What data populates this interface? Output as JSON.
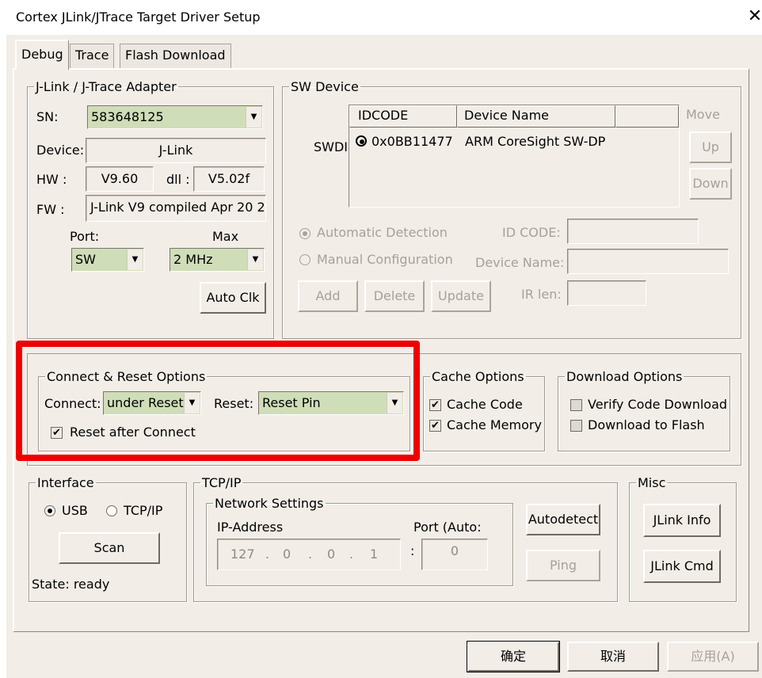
{
  "window": {
    "title": "Cortex JLink/JTrace Target Driver Setup",
    "close_glyph": "✕"
  },
  "tabs": [
    "Debug",
    "Trace",
    "Flash Download"
  ],
  "adapter": {
    "legend": "J-Link / J-Trace Adapter",
    "sn_label": "SN:",
    "sn_value": "583648125",
    "device_label": "Device:",
    "device_value": "J-Link",
    "hw_label": "HW :",
    "hw_value": "V9.60",
    "dll_label": "dll :",
    "dll_value": "V5.02f",
    "fw_label": "FW :",
    "fw_value": "J-Link V9 compiled Apr 20 2",
    "port_label": "Port:",
    "port_value": "SW",
    "max_label": "Max",
    "max_value": "2 MHz",
    "auto_clk": "Auto Clk"
  },
  "sw_device": {
    "legend": "SW Device",
    "side_label": "SWDI",
    "columns": [
      "IDCODE",
      "Device Name"
    ],
    "rows": [
      {
        "idcode": "0x0BB11477",
        "name": "ARM CoreSight SW-DP"
      }
    ],
    "move_label": "Move",
    "up": "Up",
    "down": "Down",
    "auto_detect": "Automatic Detection",
    "manual_config": "Manual Configuration",
    "id_code_label": "ID CODE:",
    "device_name_label": "Device Name:",
    "ir_len_label": "IR len:",
    "add": "Add",
    "delete": "Delete",
    "update": "Update"
  },
  "connect_reset": {
    "legend": "Connect & Reset Options",
    "connect_label": "Connect:",
    "connect_value": "under Reset",
    "reset_label": "Reset:",
    "reset_value": "Reset Pin",
    "reset_after_connect": "Reset after Connect",
    "reset_after_connect_checked": true
  },
  "cache": {
    "legend": "Cache Options",
    "cache_code": "Cache Code",
    "cache_code_checked": true,
    "cache_memory": "Cache Memory",
    "cache_memory_checked": true
  },
  "download": {
    "legend": "Download Options",
    "verify": "Verify Code Download",
    "verify_checked": false,
    "flash": "Download to Flash",
    "flash_checked": false
  },
  "interface": {
    "legend": "Interface",
    "usb": "USB",
    "tcpip": "TCP/IP",
    "selected": "USB",
    "scan": "Scan",
    "state": "State: ready"
  },
  "tcpip": {
    "legend": "TCP/IP",
    "network_legend": "Network Settings",
    "ip_label": "IP-Address",
    "port_label": "Port (Auto:",
    "ip_octets": [
      "127",
      "0",
      "0",
      "1"
    ],
    "ip_dot": ".",
    "port_sep": ":",
    "port_value": "0",
    "autodetect": "Autodetect",
    "ping": "Ping"
  },
  "misc": {
    "legend": "Misc",
    "jlink_info": "JLink Info",
    "jlink_cmd": "JLink Cmd"
  },
  "footer": {
    "ok": "确定",
    "cancel": "取消",
    "apply": "应用(A)"
  },
  "colors": {
    "highlight": "#ee0000",
    "combo_bg": "#cfddb8",
    "dialog_bg": "#f2ede7"
  },
  "icons": {
    "dropdown": "chevron-down-icon",
    "check": "check-icon",
    "close": "close-icon",
    "row_marker": "radio-selected-icon"
  }
}
